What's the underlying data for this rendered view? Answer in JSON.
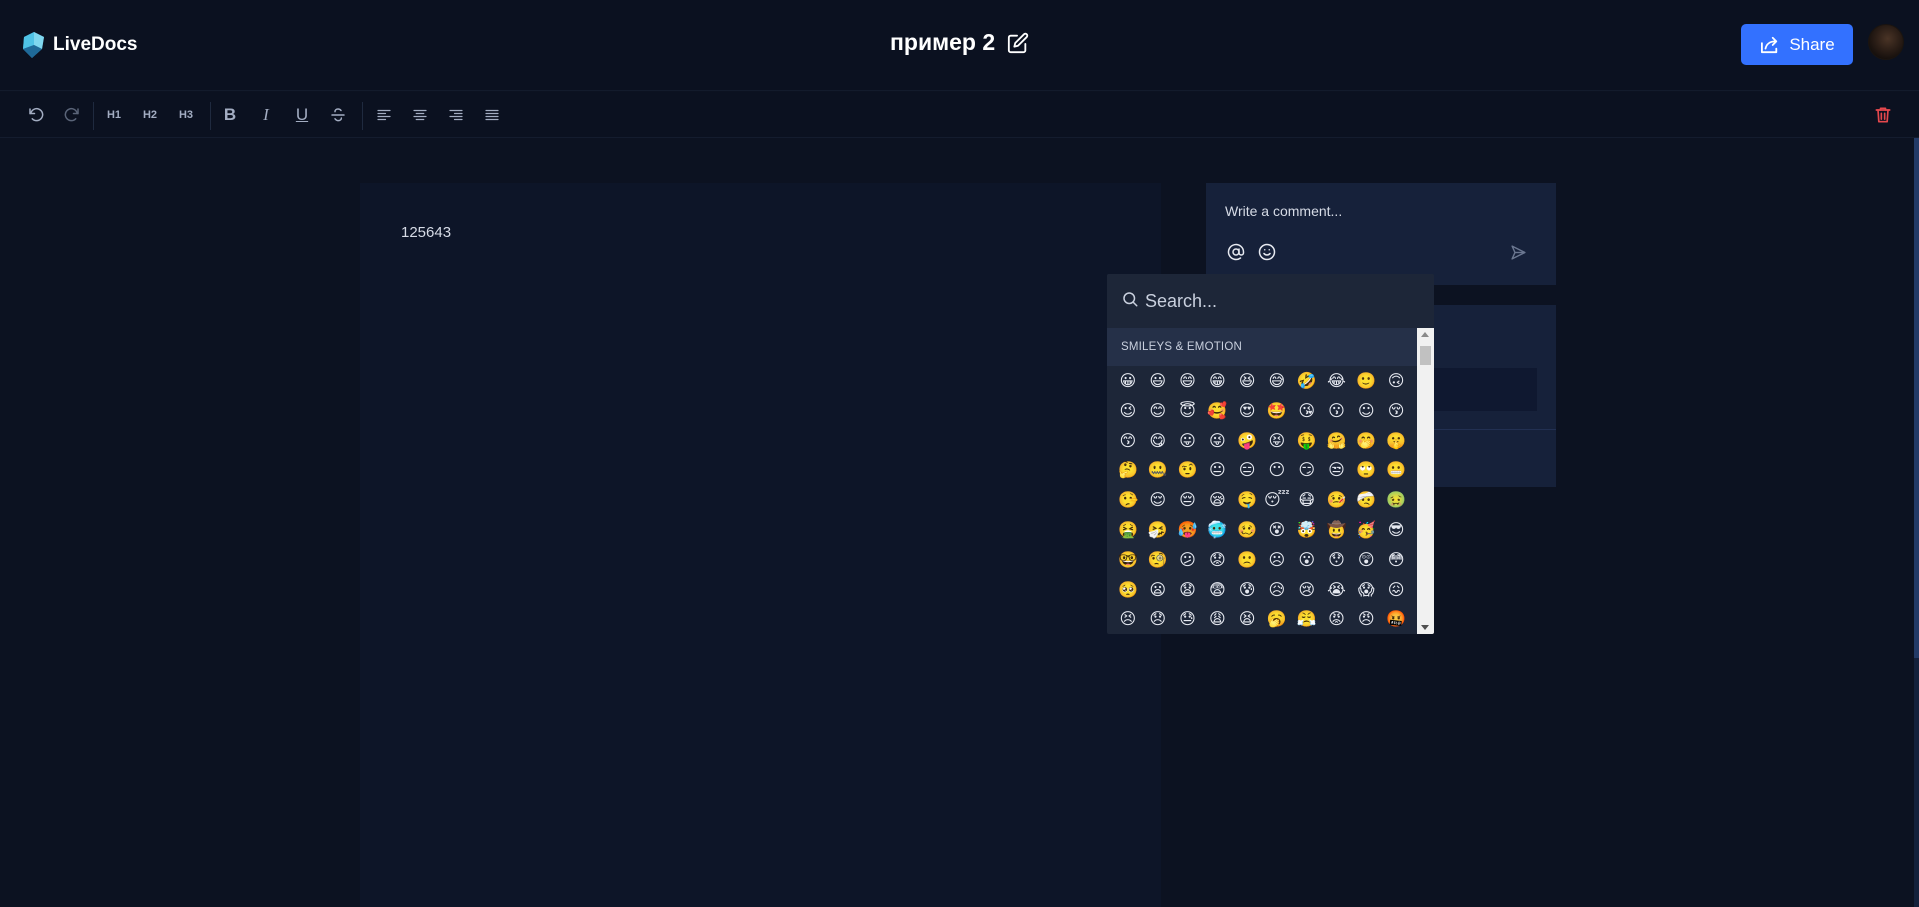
{
  "app": {
    "name": "LiveDocs",
    "document_title": "пример 2"
  },
  "header": {
    "share_label": "Share"
  },
  "toolbar": {
    "h1": "H1",
    "h2": "H2",
    "h3": "H3",
    "bold": "B",
    "italic": "I",
    "underline": "U"
  },
  "editor": {
    "content": "125643"
  },
  "comment": {
    "placeholder": "Write a comment..."
  },
  "emoji_picker": {
    "search_placeholder": "Search...",
    "category": "SMILEYS & EMOTION",
    "emojis": [
      "😀",
      "😃",
      "😄",
      "😁",
      "😆",
      "😅",
      "🤣",
      "😂",
      "🙂",
      "🙃",
      "😉",
      "😊",
      "😇",
      "🥰",
      "😍",
      "🤩",
      "😘",
      "😗",
      "☺",
      "😚",
      "😙",
      "😋",
      "😛",
      "😜",
      "🤪",
      "😝",
      "🤑",
      "🤗",
      "🤭",
      "🤫",
      "🤔",
      "🤐",
      "🤨",
      "😐",
      "😑",
      "😶",
      "😏",
      "😒",
      "🙄",
      "😬",
      "🤥",
      "😌",
      "😔",
      "😪",
      "🤤",
      "😴",
      "😷",
      "🤒",
      "🤕",
      "🤢",
      "🤮",
      "🤧",
      "🥵",
      "🥶",
      "🥴",
      "😵",
      "🤯",
      "🤠",
      "🥳",
      "😎",
      "🤓",
      "🧐",
      "😕",
      "😟",
      "🙁",
      "☹",
      "😮",
      "😯",
      "😲",
      "😳",
      "🥺",
      "😦",
      "😧",
      "😨",
      "😰",
      "😥",
      "😢",
      "😭",
      "😱",
      "😖",
      "😣",
      "😞",
      "😓",
      "😩",
      "😫",
      "🥱",
      "😤",
      "😡",
      "😠",
      "🤬"
    ]
  },
  "colors": {
    "background": "#0c1221",
    "accent": "#3371ff",
    "danger": "#e5484d"
  }
}
